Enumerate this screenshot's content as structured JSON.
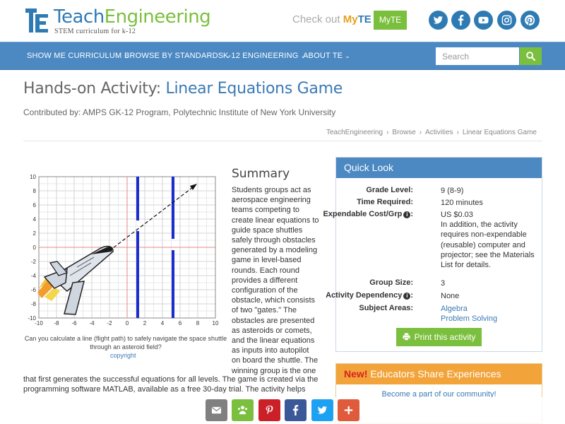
{
  "header": {
    "logo_part1": "Teach",
    "logo_part2": "Engineering",
    "logo_tagline": "STEM curriculum for k-12",
    "checkout_text": "Check out ",
    "checkout_my": "My",
    "checkout_te": "TE",
    "myte_button": "MyTE",
    "social_icons": [
      "twitter-icon",
      "facebook-icon",
      "youtube-icon",
      "instagram-icon",
      "pinterest-icon"
    ]
  },
  "nav": {
    "items": [
      {
        "label": "SHOW ME CURRICULUM"
      },
      {
        "label": "BROWSE BY STANDARDS"
      },
      {
        "label": "K-12 ENGINEERING"
      },
      {
        "label": "ABOUT TE"
      }
    ],
    "search_placeholder": "Search"
  },
  "page": {
    "title_prefix": "Hands-on Activity: ",
    "title_name": "Linear Equations Game",
    "contributed": "Contributed by: AMPS GK-12 Program, Polytechnic Institute of New York University",
    "breadcrumb": [
      "TeachEngineering",
      "Browse",
      "Activities",
      "Linear Equations Game"
    ]
  },
  "figure": {
    "x_ticks": [
      "-10",
      "-8",
      "-6",
      "-4",
      "-2",
      "0",
      "2",
      "4",
      "6",
      "8",
      "10"
    ],
    "y_ticks": [
      "10",
      "8",
      "6",
      "4",
      "2",
      "0",
      "-2",
      "-4",
      "-6",
      "-8",
      "-10"
    ],
    "caption": "Can you calculate a line (flight path) to safely navigate the space shuttle through an asteroid field?",
    "copyright": "copyright"
  },
  "summary": {
    "heading": "Summary",
    "text_narrow": "Students groups act as aerospace engineering teams competing to create linear equations to guide space shuttles safely through obstacles generated by a modeling game in level-based rounds. Each round provides a different configuration of the obstacle, which consists of two \"gates.\" The obstacles are presented as asteroids or comets, and the linear equations as inputs into autopilot on board the shuttle. The winning group is the one",
    "text_wide": "that first generates the successful equations for all levels. The game is created via the programming software MATLAB, available as a free 30-day trial. The activity helps"
  },
  "quick_look": {
    "heading": "Quick Look",
    "grade_label": "Grade Level:",
    "grade_value": "9 (8-9)",
    "time_label": "Time Required:",
    "time_value": "120 minutes",
    "cost_label": "Expendable Cost/Grp",
    "cost_value": "US $0.03",
    "cost_note": "In addition, the activity requires non-expendable (reusable) computer and projector; see the Materials List for details.",
    "group_label": "Group Size:",
    "group_value": "3",
    "dependency_label": "Activity Dependency",
    "dependency_value": "None",
    "subject_label": "Subject Areas:",
    "subject_1": "Algebra",
    "subject_2": "Problem Solving",
    "print_button": "Print this activity"
  },
  "educators": {
    "new_label": "New!",
    "heading": " Educators Share Experiences",
    "subtext": "Become a part of our community!"
  },
  "share_bar": {
    "icons": [
      "email-icon",
      "share-community-icon",
      "pinterest-icon",
      "facebook-icon",
      "twitter-icon",
      "more-plus-icon"
    ],
    "colors": [
      "#808080",
      "#7bbf3e",
      "#cb2027",
      "#3b5998",
      "#1da1f2",
      "#e05a3c"
    ]
  },
  "colors": {
    "brand_blue": "#4c89c3",
    "brand_green": "#7bbf3e",
    "accent_orange": "#f2a33a"
  }
}
